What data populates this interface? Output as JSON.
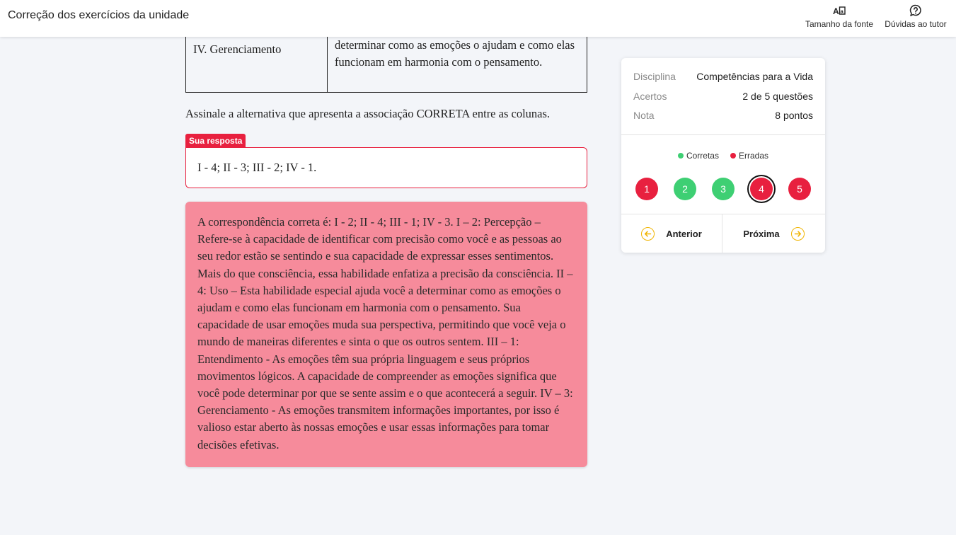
{
  "header": {
    "title": "Correção dos exercícios da unidade",
    "font_size_label": "Tamanho da fonte",
    "tutor_label": "Dúvidas ao tutor"
  },
  "question": {
    "table_row": {
      "item": "IV. Gerenciamento",
      "description": "determinar como as emoções o ajudam e como elas funcionam em harmonia com o pensamento."
    },
    "prompt": "Assinale a alternativa que apresenta a associação CORRETA entre as colunas.",
    "answer_tag": "Sua resposta",
    "answer": "I - 4; II - 3; III - 2; IV - 1.",
    "feedback": "A correspondência correta é:  I - 2; II - 4; III - 1; IV - 3. I – 2: Percepção – Refere-se à capacidade de identificar com precisão como você e as pessoas ao seu redor estão se sentindo e sua capacidade de expressar esses sentimentos. Mais do que consciência, essa habilidade enfatiza a precisão da consciência. II – 4: Uso – Esta habilidade especial ajuda você a determinar como as emoções o ajudam e como elas funcionam em harmonia com o pensamento. Sua capacidade de usar emoções muda sua perspectiva, permitindo que você veja o mundo de maneiras diferentes e sinta o que os outros sentem. III – 1: Entendimento - As emoções têm sua própria linguagem e seus próprios movimentos lógicos. A capacidade de compreender as emoções significa que você pode determinar por que se sente assim e o que acontecerá a seguir. IV – 3: Gerenciamento - As emoções transmitem informações importantes, por isso é valioso estar aberto às nossas emoções e usar essas informações para tomar decisões efetivas."
  },
  "summary": {
    "discipline_label": "Disciplina",
    "discipline_value": "Competências para a Vida",
    "hits_label": "Acertos",
    "hits_value": "2 de 5 questões",
    "grade_label": "Nota",
    "grade_value": "8 pontos",
    "legend_correct": "Corretas",
    "legend_wrong": "Erradas",
    "questions": [
      {
        "number": "1",
        "status": "wrong"
      },
      {
        "number": "2",
        "status": "correct"
      },
      {
        "number": "3",
        "status": "correct"
      },
      {
        "number": "4",
        "status": "wrong",
        "current": true
      },
      {
        "number": "5",
        "status": "wrong"
      }
    ],
    "prev_label": "Anterior",
    "next_label": "Próxima"
  },
  "colors": {
    "correct": "#3ecf73",
    "wrong": "#e8203f",
    "feedback_bg": "#f68b9b",
    "nav_accent": "#f0b400"
  },
  "icons": {
    "font_size": "font-size-icon",
    "tutor": "help-bubble-icon",
    "prev": "arrow-left-circle-icon",
    "next": "arrow-right-circle-icon"
  }
}
